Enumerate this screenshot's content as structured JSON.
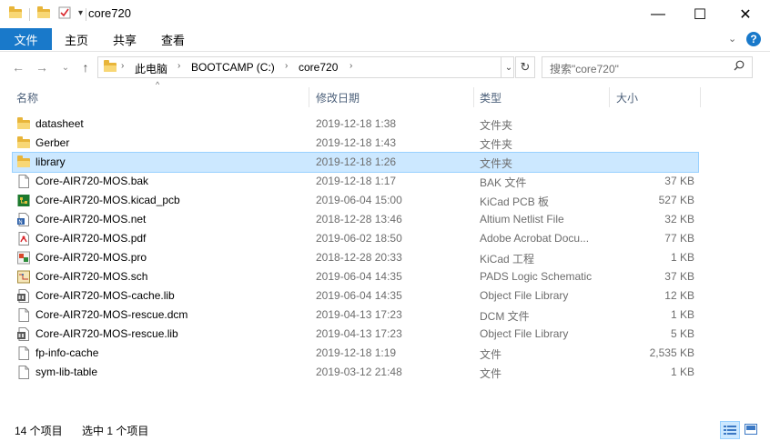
{
  "window": {
    "title": "core720",
    "minimize_glyph": "—",
    "maximize_glyph": "☐",
    "close_glyph": "✕"
  },
  "ribbon": {
    "tabs": [
      {
        "label": "文件"
      },
      {
        "label": "主页"
      },
      {
        "label": "共享"
      },
      {
        "label": "查看"
      }
    ],
    "help_glyph": "?",
    "expand_glyph": "⌄"
  },
  "navigation": {
    "back_glyph": "←",
    "forward_glyph": "→",
    "recent_glyph": "⌄",
    "up_glyph": "↑",
    "breadcrumbs": [
      "此电脑",
      "BOOTCAMP (C:)",
      "core720"
    ],
    "breadcrumb_sep": "›",
    "dropdown_glyph": "⌄",
    "refresh_glyph": "↻",
    "search_placeholder": "搜索\"core720\""
  },
  "columns": {
    "name": "名称",
    "date": "修改日期",
    "type": "类型",
    "size": "大小",
    "sort_glyph": "^"
  },
  "files": [
    {
      "name": "datasheet",
      "date": "2019-12-18 1:38",
      "type": "文件夹",
      "size": "",
      "icon": "folder-icon",
      "selected": false
    },
    {
      "name": "Gerber",
      "date": "2019-12-18 1:43",
      "type": "文件夹",
      "size": "",
      "icon": "folder-icon",
      "selected": false
    },
    {
      "name": "library",
      "date": "2019-12-18 1:26",
      "type": "文件夹",
      "size": "",
      "icon": "folder-icon",
      "selected": true
    },
    {
      "name": "Core-AIR720-MOS.bak",
      "date": "2019-12-18 1:17",
      "type": "BAK 文件",
      "size": "37 KB",
      "icon": "blank-file-icon",
      "selected": false
    },
    {
      "name": "Core-AIR720-MOS.kicad_pcb",
      "date": "2019-06-04 15:00",
      "type": "KiCad PCB 板",
      "size": "527 KB",
      "icon": "kicad-pcb-icon",
      "selected": false
    },
    {
      "name": "Core-AIR720-MOS.net",
      "date": "2018-12-28 13:46",
      "type": "Altium Netlist File",
      "size": "32 KB",
      "icon": "altium-netlist-icon",
      "selected": false
    },
    {
      "name": "Core-AIR720-MOS.pdf",
      "date": "2019-06-02 18:50",
      "type": "Adobe Acrobat Docu...",
      "size": "77 KB",
      "icon": "pdf-icon",
      "selected": false
    },
    {
      "name": "Core-AIR720-MOS.pro",
      "date": "2018-12-28 20:33",
      "type": "KiCad 工程",
      "size": "1 KB",
      "icon": "kicad-project-icon",
      "selected": false
    },
    {
      "name": "Core-AIR720-MOS.sch",
      "date": "2019-06-04 14:35",
      "type": "PADS Logic Schematic",
      "size": "37 KB",
      "icon": "schematic-icon",
      "selected": false
    },
    {
      "name": "Core-AIR720-MOS-cache.lib",
      "date": "2019-06-04 14:35",
      "type": "Object File Library",
      "size": "12 KB",
      "icon": "library-file-icon",
      "selected": false
    },
    {
      "name": "Core-AIR720-MOS-rescue.dcm",
      "date": "2019-04-13 17:23",
      "type": "DCM 文件",
      "size": "1 KB",
      "icon": "blank-file-icon",
      "selected": false
    },
    {
      "name": "Core-AIR720-MOS-rescue.lib",
      "date": "2019-04-13 17:23",
      "type": "Object File Library",
      "size": "5 KB",
      "icon": "library-file-icon",
      "selected": false
    },
    {
      "name": "fp-info-cache",
      "date": "2019-12-18 1:19",
      "type": "文件",
      "size": "2,535 KB",
      "icon": "blank-file-icon",
      "selected": false
    },
    {
      "name": "sym-lib-table",
      "date": "2019-03-12 21:48",
      "type": "文件",
      "size": "1 KB",
      "icon": "blank-file-icon",
      "selected": false
    }
  ],
  "status": {
    "item_count": "14 个项目",
    "selected_count": "选中 1 个项目"
  },
  "colors": {
    "accent": "#1979ca",
    "selection": "#cce8ff",
    "folder": "#e8b53a"
  }
}
